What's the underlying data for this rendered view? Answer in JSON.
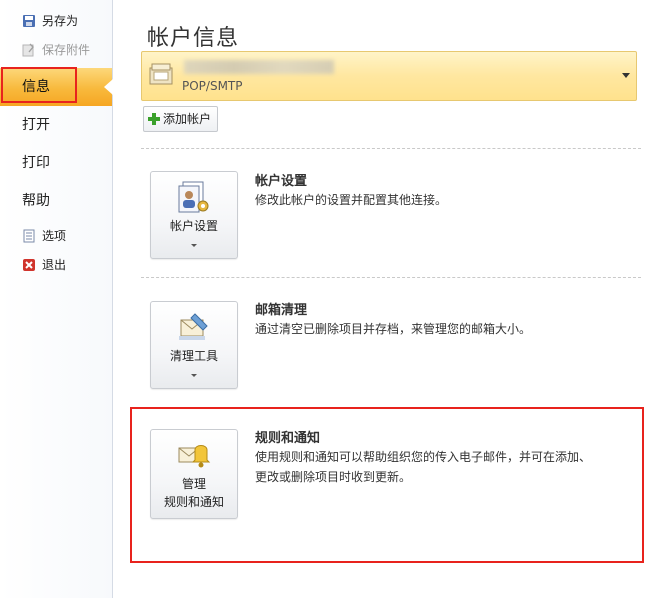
{
  "nav": {
    "save_as": "另存为",
    "save_attachments": "保存附件",
    "info": "信息",
    "open": "打开",
    "print": "打印",
    "help": "帮助",
    "options": "选项",
    "exit": "退出"
  },
  "main": {
    "title": "帐户信息",
    "account": {
      "type": "POP/SMTP"
    },
    "add_account": "添加帐户",
    "sections": [
      {
        "button_label": "帐户设置",
        "title": "帐户设置",
        "description": "修改此帐户的设置并配置其他连接。",
        "icon": "account-settings-icon"
      },
      {
        "button_label": "清理工具",
        "title": "邮箱清理",
        "description": "通过清空已删除项目并存档，来管理您的邮箱大小。",
        "icon": "cleanup-tools-icon"
      },
      {
        "button_label_line1": "管理",
        "button_label_line2": "规则和通知",
        "title": "规则和通知",
        "description_line1": "使用规则和通知可以帮助组织您的传入电子邮件，并可在添加、",
        "description_line2": "更改或删除项目时收到更新。",
        "icon": "rules-alerts-icon"
      }
    ]
  },
  "colors": {
    "highlight_red": "#e8231d",
    "nav_selected": "#f8b93c",
    "dropdown_bg": "#ffe7a0"
  }
}
